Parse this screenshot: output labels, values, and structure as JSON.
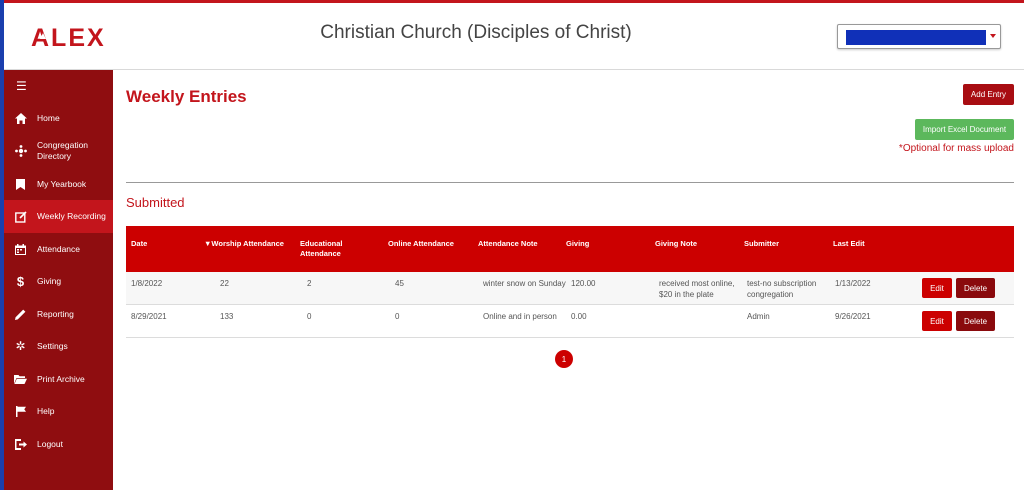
{
  "header": {
    "logo_text": "ALEX",
    "church_name": "Christian Church (Disciples of Christ)",
    "user_select_value": ""
  },
  "sidebar": {
    "menu_icon": "hamburger-icon",
    "items": [
      {
        "label": "Home",
        "icon": "home-icon",
        "active": false
      },
      {
        "label": "Congregation Directory",
        "icon": "directory-icon",
        "active": false
      },
      {
        "label": "My Yearbook",
        "icon": "bookmark-icon",
        "active": false
      },
      {
        "label": "Weekly Recording",
        "icon": "edit-square-icon",
        "active": true
      },
      {
        "label": "Attendance",
        "icon": "calendar-icon",
        "active": false
      },
      {
        "label": "Giving",
        "icon": "dollar-icon",
        "active": false
      },
      {
        "label": "Reporting",
        "icon": "pencil-icon",
        "active": false
      },
      {
        "label": "Settings",
        "icon": "gear-icon",
        "active": false
      },
      {
        "label": "Print Archive",
        "icon": "folder-icon",
        "active": false
      },
      {
        "label": "Help",
        "icon": "flag-icon",
        "active": false
      },
      {
        "label": "Logout",
        "icon": "logout-icon",
        "active": false
      }
    ]
  },
  "main": {
    "page_title": "Weekly Entries",
    "add_entry_label": "Add Entry",
    "import_excel_label": "Import Excel Document",
    "optional_note": "*Optional for mass upload",
    "section_title": "Submitted",
    "table": {
      "columns": [
        "Date",
        "▼Worship Attendance",
        "Educational Attendance",
        "Online Attendance",
        "Attendance Note",
        "Giving",
        "Giving Note",
        "Submitter",
        "Last Edit"
      ],
      "rows": [
        {
          "date": "1/8/2022",
          "worship": "22",
          "educational": "2",
          "online": "45",
          "attendance_note": "winter snow on Sunday",
          "giving": "120.00",
          "giving_note": "received most online, $20 in the plate",
          "submitter": "test-no subscription congregation",
          "last_edit": "1/13/2022"
        },
        {
          "date": "8/29/2021",
          "worship": "133",
          "educational": "0",
          "online": "0",
          "attendance_note": "Online and in person",
          "giving": "0.00",
          "giving_note": "",
          "submitter": "Admin",
          "last_edit": "9/26/2021"
        }
      ],
      "edit_label": "Edit",
      "delete_label": "Delete"
    },
    "pagination": {
      "current_page": "1"
    }
  },
  "colors": {
    "brand_red": "#c3151c",
    "sidebar_dark": "#8f0d10",
    "success_green": "#5cb85c",
    "header_red": "#cc0000"
  }
}
